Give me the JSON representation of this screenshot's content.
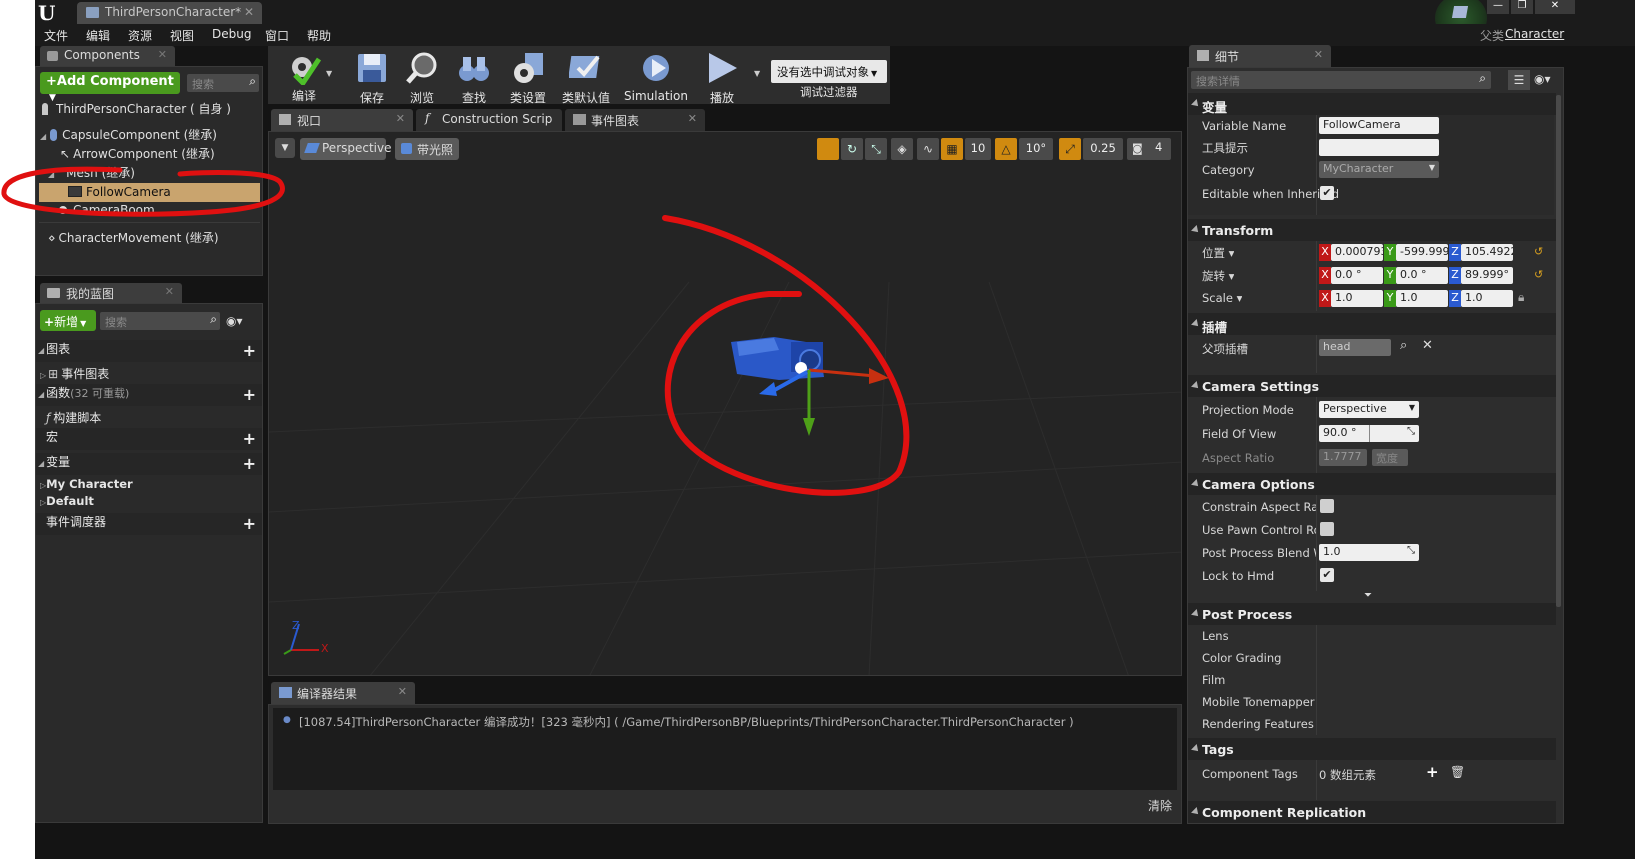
{
  "window": {
    "logo": "U",
    "doc_tab": "ThirdPersonCharacter*",
    "parent_label": "父类",
    "parent_value": "Character",
    "controls": [
      "—",
      "❐",
      "✕"
    ]
  },
  "menu": [
    "文件",
    "编辑",
    "资源",
    "视图",
    "Debug",
    "窗口",
    "帮助"
  ],
  "components_panel": {
    "tab": "Components",
    "add_button": "+Add Component",
    "search_placeholder": "搜索",
    "root": "ThirdPersonCharacter ( 自身 )",
    "items": [
      "CapsuleComponent (继承)",
      "ArrowComponent (继承)",
      "Mesh (继承)",
      "FollowCamera",
      "CameraBoom",
      "CharacterMovement (继承)"
    ]
  },
  "my_blueprint": {
    "tab": "我的蓝图",
    "new_button": "新增",
    "search_placeholder": "搜索",
    "graphs": "图表",
    "event_graph": "事件图表",
    "functions": "函数",
    "functions_count": "(32 可重载)",
    "construction_script": "构建脚本",
    "macros": "宏",
    "variables": "变量",
    "var_groups": [
      "My Character",
      "Default"
    ],
    "dispatchers": "事件调度器"
  },
  "toolbar": {
    "buttons": [
      "编译",
      "保存",
      "浏览",
      "查找",
      "类设置",
      "类默认值",
      "Simulation",
      "播放"
    ],
    "debug_dropdown": "没有选中调试对象",
    "debug_filter": "调试过滤器"
  },
  "editor_tabs": [
    "视口",
    "Construction Scrip",
    "事件图表"
  ],
  "viewport": {
    "mode": "Perspective",
    "lighting": "带光照",
    "grid_snap": "10",
    "rot_snap": "10°",
    "scale_snap": "0.25",
    "cam_speed": "4",
    "axis_x": "X",
    "axis_z": "Z"
  },
  "compiler": {
    "tab": "编译器结果",
    "message": "[1087.54]ThirdPersonCharacter 编译成功！[323 毫秒内] ( /Game/ThirdPersonBP/Blueprints/ThirdPersonCharacter.ThirdPersonCharacter )",
    "clear": "清除"
  },
  "details": {
    "tab": "细节",
    "search_placeholder": "搜索详情",
    "variable": {
      "title": "变量",
      "name_label": "Variable Name",
      "name_value": "FollowCamera",
      "tooltip_label": "工具提示",
      "category_label": "Category",
      "category_value": "MyCharacter",
      "editable_label": "Editable when Inherited"
    },
    "transform": {
      "title": "Transform",
      "location": "位置",
      "rotation": "旋转",
      "scale": "Scale",
      "loc": [
        "0.000793",
        "-599.999",
        "105.4922"
      ],
      "rot": [
        "0.0 °",
        "0.0 °",
        "89.999°"
      ],
      "scl": [
        "1.0",
        "1.0",
        "1.0"
      ]
    },
    "socket": {
      "title": "插槽",
      "parent_label": "父项插槽",
      "parent_value": "head"
    },
    "camera_settings": {
      "title": "Camera Settings",
      "proj_label": "Projection Mode",
      "proj_value": "Perspective",
      "fov_label": "Field Of View",
      "fov_value": "90.0 °",
      "aspect_label": "Aspect Ratio",
      "aspect_value": "1.7777",
      "aspect_extra": "宽度"
    },
    "camera_options": {
      "title": "Camera Options",
      "constrain": "Constrain Aspect Ratio",
      "pawn_rot": "Use Pawn Control Rotat",
      "ppbw": "Post Process Blend We",
      "ppbw_value": "1.0",
      "hmd": "Lock to Hmd"
    },
    "post_process": {
      "title": "Post Process",
      "items": [
        "Lens",
        "Color Grading",
        "Film",
        "Mobile Tonemapper",
        "Rendering Features"
      ]
    },
    "tags": {
      "title": "Tags",
      "label": "Component Tags",
      "value": "0 数组元素"
    },
    "replication": {
      "title": "Component Replication"
    }
  },
  "colors": {
    "accent_green": "#4a9a1e",
    "selection": "#c9a46e",
    "annotation_red": "#e01010",
    "axis_x": "#c01818",
    "axis_y": "#3a9a18",
    "axis_z": "#2a5ad0"
  }
}
